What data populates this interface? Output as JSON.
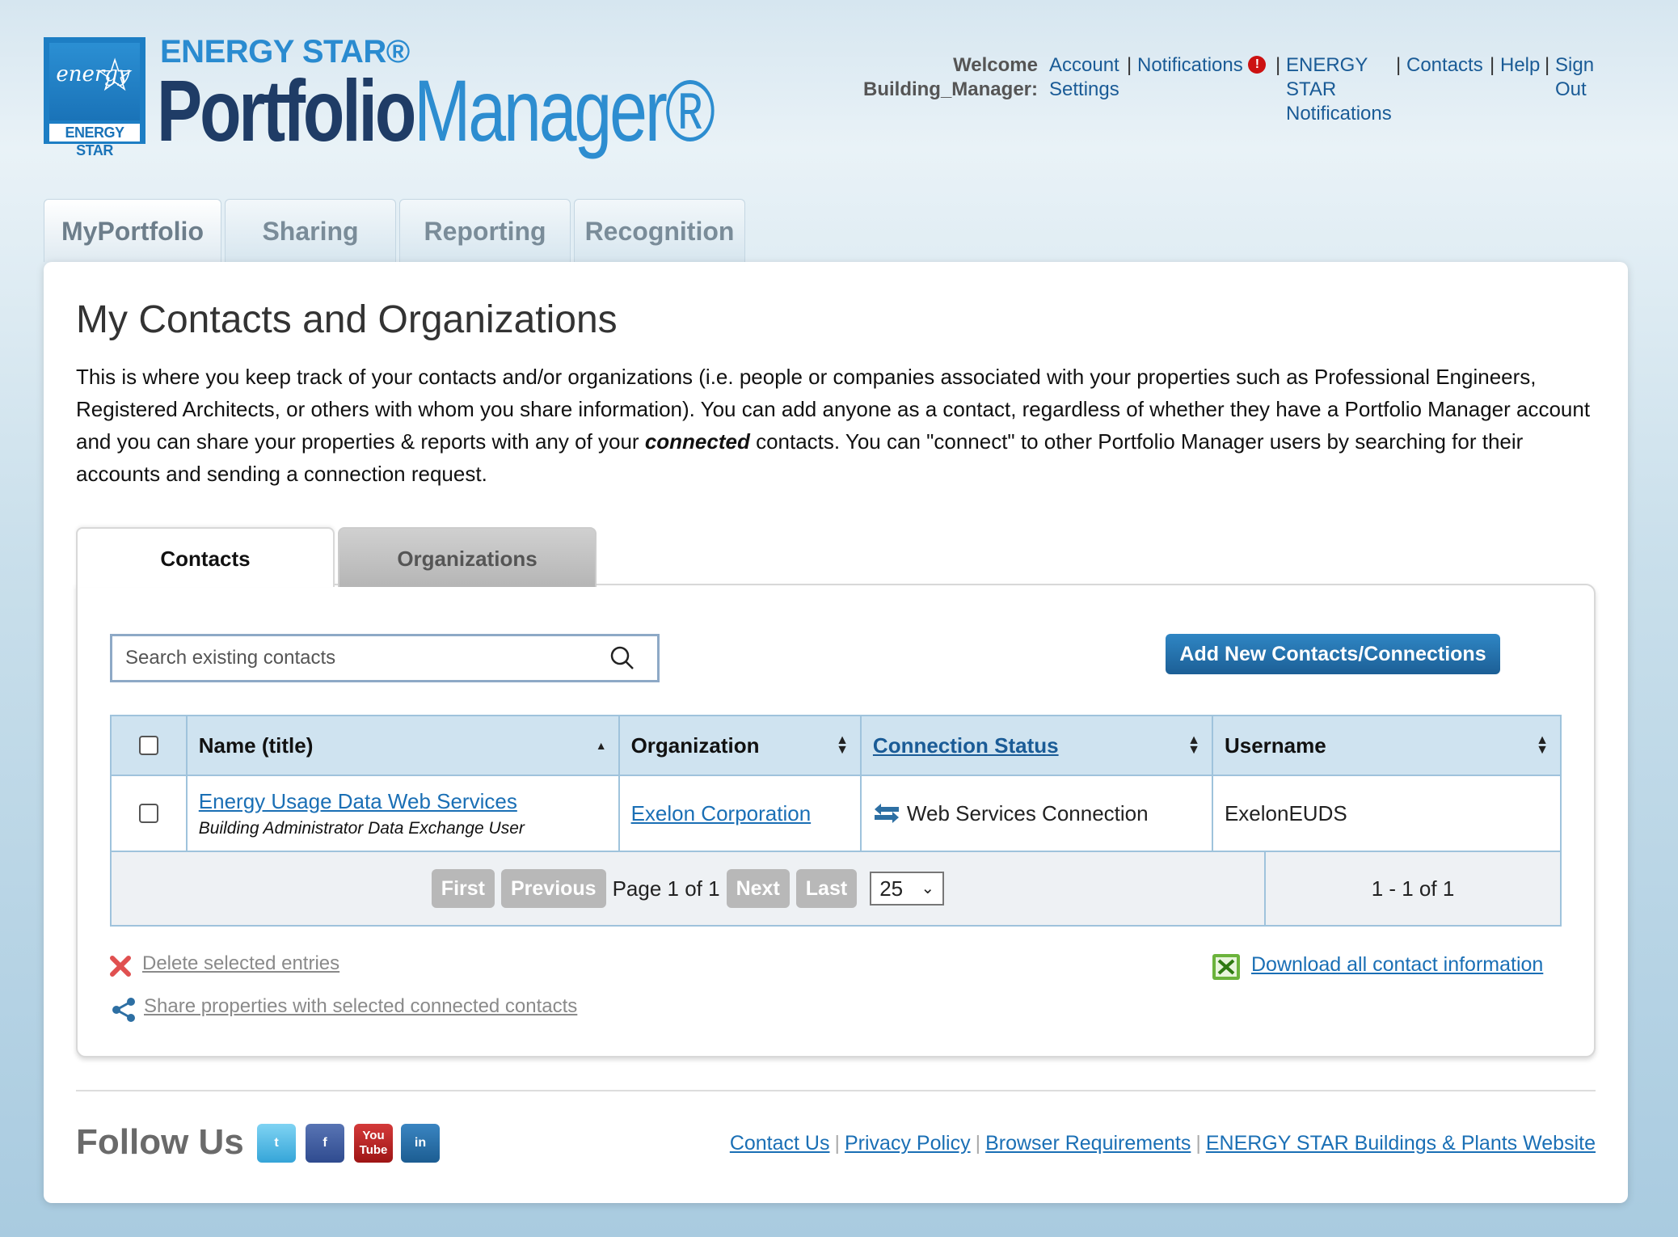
{
  "logo": {
    "es_text": "ENERGY STAR®",
    "pm_part1": "Portfolio",
    "pm_part2": "Manager®",
    "box_script": "energy",
    "box_band": "ENERGY STAR"
  },
  "header": {
    "welcome_line1": "Welcome",
    "welcome_line2": "Building_Manager:",
    "account_settings_line1": "Account",
    "account_settings_line2": "Settings",
    "notifications": "Notifications",
    "alert_symbol": "!",
    "es_notifications_line1": "ENERGY",
    "es_notifications_line2": "STAR",
    "es_notifications_line3": "Notifications",
    "contacts": "Contacts",
    "help": "Help",
    "sign_out_line1": "Sign",
    "sign_out_line2": "Out",
    "separator": "|"
  },
  "main_tabs": [
    {
      "label": "MyPortfolio"
    },
    {
      "label": "Sharing"
    },
    {
      "label": "Reporting"
    },
    {
      "label": "Recognition"
    }
  ],
  "page": {
    "title": "My Contacts and Organizations",
    "intro_part1": "This is where you keep track of your contacts and/or organizations (i.e. people or companies associated with your properties such as Professional Engineers, Registered Architects, or others with whom you share information). You can add anyone as a contact, regardless of whether they have a Portfolio Manager account and you can share your properties & reports with any of your ",
    "intro_em": "connected",
    "intro_part2": " contacts. You can \"connect\" to other Portfolio Manager users by searching for their accounts and sending a connection request."
  },
  "sub_tabs": {
    "contacts": "Contacts",
    "organizations": "Organizations"
  },
  "search": {
    "placeholder": "Search existing contacts"
  },
  "add_button": "Add New Contacts/Connections",
  "table": {
    "headers": {
      "name": "Name (title)",
      "organization": "Organization",
      "connection_status": "Connection Status",
      "username": "Username"
    },
    "rows": [
      {
        "name": "Energy Usage Data Web Services",
        "title": "Building Administrator Data Exchange User",
        "organization": "Exelon Corporation",
        "connection_status": "Web Services Connection",
        "username": "ExelonEUDS"
      }
    ],
    "pager": {
      "first": "First",
      "previous": "Previous",
      "page_info": "Page 1 of 1",
      "next": "Next",
      "last": "Last",
      "page_size": "25",
      "range": "1 - 1 of 1"
    }
  },
  "actions": {
    "delete": "Delete selected entries",
    "share": "Share properties with selected connected contacts",
    "download": "Download all contact information"
  },
  "footer": {
    "follow_us": "Follow Us",
    "social": [
      "twitter-icon",
      "facebook-icon",
      "youtube-icon",
      "linkedin-icon"
    ],
    "links": [
      "Contact Us",
      "Privacy Policy",
      "Browser Requirements",
      "ENERGY STAR Buildings & Plants Website"
    ]
  },
  "colors": {
    "link": "#1a5b96",
    "button_blue": "#1c5f96",
    "table_header": "#cfe3f0",
    "alert_red": "#cc1111"
  }
}
